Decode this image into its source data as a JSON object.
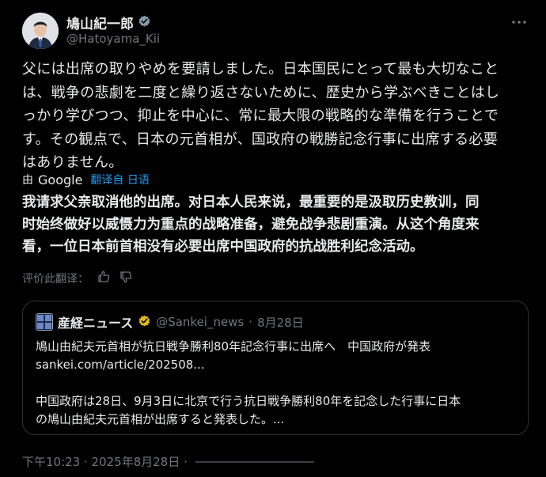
{
  "author": {
    "name": "鳩山紀一郎",
    "handle": "@Hatoyama_Kii"
  },
  "post": {
    "original_lines": [
      "父には出席の取りやめを要請しました。日本国民にとって最も大切なこと",
      "は、戦争の悲劇を二度と繰り返さないために、歴史から学ぶべきことはし",
      "っかり学びつつ、抑止を中心に、常に最大限の戦略的な準備を行うことで",
      "す。その観点で、日本の元首相が、国政府の戦勝記念行事に出席する必要",
      "はありません。"
    ],
    "translated_lines": [
      "我请求父亲取消他的出席。对日本人民来说，最重要的是汲取历史教训，同",
      "时始终做好以威慑力为重点的战略准备，避免战争悲剧重演。从这个角度来",
      "看，一位日本前首相没有必要出席中国政府的抗战胜利纪念活动。"
    ]
  },
  "translation": {
    "by": "由",
    "provider": "Google",
    "from": "翻译自 日语",
    "rate_label": "评价此翻译："
  },
  "quote": {
    "name": "産経ニュース",
    "handle": "@Sankei_news",
    "separator": "·",
    "date": "8月28日",
    "line1": "鳩山由紀夫元首相が抗日戦争勝利80年記念行事に出席へ　中国政府が発表",
    "line2": "sankei.com/article/202508...",
    "line3": "中国政府は28日、9月3日に北京で行う抗日戦争勝利80年を記念した行事に日本",
    "line4": "の鳩山由紀夫元首相が出席すると発表した。..."
  },
  "footer": {
    "timestamp": "下午10:23 · 2025年8月28日 ·"
  },
  "colors": {
    "background": "#000000",
    "text": "#e7e9ea",
    "muted": "#71767b",
    "link": "#1d9bf0",
    "border": "#2f3336",
    "verified_gray": "#829aab",
    "verified_gold": "#e2b719"
  }
}
